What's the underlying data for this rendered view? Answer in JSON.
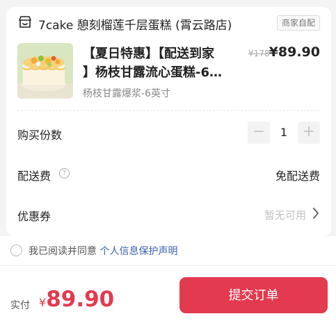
{
  "store": {
    "name": "7cake 憩刻榴莲千层蛋糕 (霄云路店)",
    "tag": "商家自配"
  },
  "product": {
    "name_line1": "【夏日特惠】【配送到家",
    "name_line2": "】杨枝甘露流心蛋糕-6…",
    "original_price": "¥178",
    "price": "¥89.90",
    "spec": "杨枝甘露爆浆-6英寸"
  },
  "quantity": {
    "label": "购买份数",
    "value": "1",
    "minus": "−",
    "plus": "+"
  },
  "shipping": {
    "label": "配送费",
    "help": "?",
    "value": "免配送费"
  },
  "coupon": {
    "label": "优惠券",
    "value": "暂无可用"
  },
  "agreement": {
    "text": "我已阅读并同意",
    "link": "个人信息保护声明",
    "checked": false
  },
  "footer": {
    "pay_label": "实付",
    "currency": "¥",
    "amount": "89.90",
    "submit_label": "提交订单"
  },
  "colors": {
    "accent": "#e33a4f",
    "link": "#3a61b0"
  },
  "icons": {
    "store": "store-icon",
    "help": "question-circle-icon",
    "chevron": "chevron-right-icon",
    "radio": "radio-unchecked-icon"
  }
}
